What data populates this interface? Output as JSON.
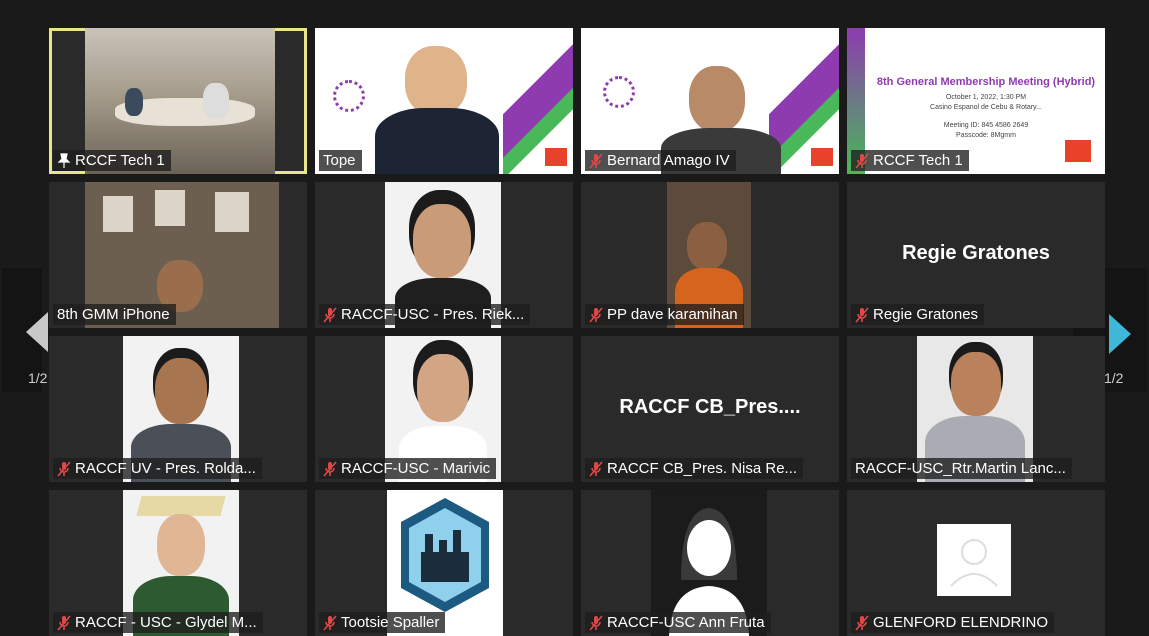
{
  "meeting": {
    "page_left": "1/2",
    "page_right": "1/2",
    "colors": {
      "active_border": "#e9e58a",
      "muted_mic": "#e04848",
      "next_arrow": "#3fb7d8",
      "tile_bg": "#2a2a2a"
    }
  },
  "tiles": [
    {
      "name": "RCCF Tech 1",
      "muted": false,
      "pinned": true,
      "active": true,
      "picture": "conference-room-video"
    },
    {
      "name": "Tope",
      "muted": false,
      "picture": "rotary-slide-video"
    },
    {
      "name": "Bernard Amago IV",
      "muted": true,
      "picture": "rotary-slide-video"
    },
    {
      "name": "RCCF Tech 1",
      "muted": true,
      "picture": "meeting-slide-video",
      "slide": {
        "title": "8th General Membership Meeting (Hybrid)",
        "line1": "October 1, 2022, 1:30 PM",
        "line2": "Casino Espanol de Cebu & Rotary...",
        "line3": "Meeting ID: 845 4586 2649",
        "line4": "Passcode: 8Mgmm"
      }
    },
    {
      "name": "8th GMM iPhone",
      "muted": false,
      "picture": "room-video"
    },
    {
      "name": "RACCF-USC - Pres. Riek...",
      "muted": true,
      "picture": "portrait"
    },
    {
      "name": "PP dave karamihan",
      "muted": true,
      "picture": "video"
    },
    {
      "name": "Regie Gratones",
      "muted": true,
      "picture": "name-only",
      "display_name": "Regie Gratones"
    },
    {
      "name": "RACCF UV - Pres. Rolda...",
      "muted": true,
      "picture": "portrait"
    },
    {
      "name": "RACCF-USC - Marivic",
      "muted": true,
      "picture": "portrait"
    },
    {
      "name": "RACCF CB_Pres. Nisa Re...",
      "muted": true,
      "picture": "name-only",
      "display_name": "RACCF CB_Pres...."
    },
    {
      "name": "RACCF-USC_Rtr.Martin Lanc...",
      "muted": false,
      "picture": "portrait"
    },
    {
      "name": "RACCF - USC - Glydel M...",
      "muted": true,
      "picture": "graduation-portrait"
    },
    {
      "name": "Tootsie Spaller",
      "muted": true,
      "picture": "badge-logo"
    },
    {
      "name": "RACCF-USC Ann Fruta",
      "muted": true,
      "picture": "avatar-silhouette"
    },
    {
      "name": "GLENFORD ELENDRINO",
      "muted": true,
      "picture": "default-avatar"
    }
  ]
}
